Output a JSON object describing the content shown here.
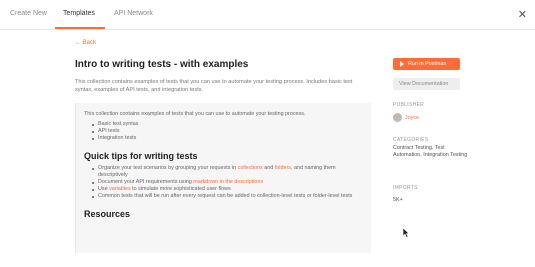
{
  "tabs": [
    {
      "label": "Create New"
    },
    {
      "label": "Templates"
    },
    {
      "label": "API Network"
    }
  ],
  "back_label": "Back",
  "title": "Intro to writing tests - with examples",
  "description": "This collection contains examples of tests that you can use to automate your testing process. Includes basic test syntax, examples of API tests, and integration tests.",
  "content": {
    "intro": "This collection contains examples of tests that you can use to automate your testing process.",
    "intro_list": [
      "Basic test syntax",
      "API tests",
      "Integration tests"
    ],
    "quick_tips_heading": "Quick tips for writing tests",
    "tips": [
      {
        "pre": "Organize your test scenarios by grouping your requests in ",
        "link1": "collections",
        "mid": " and ",
        "link2": "folders",
        "post": ", and naming them descriptively"
      },
      {
        "pre": "Document your API requirements using ",
        "link1": "markdown in the descriptions",
        "mid": "",
        "link2": "",
        "post": ""
      },
      {
        "pre": "Use ",
        "link1": "variables",
        "mid": "",
        "link2": "",
        "post": " to simulate more sophisticated user flows"
      },
      {
        "pre": "Common tests that will be run after every request can be added to collection-level tests or folder-level tests",
        "link1": "",
        "mid": "",
        "link2": "",
        "post": ""
      }
    ],
    "resources_heading": "Resources"
  },
  "sidebar": {
    "run_label": "Run in Postman",
    "docs_label": "View Documentation",
    "publisher_heading": "PUBLISHER",
    "publisher_name": "Joyce",
    "categories_heading": "CATEGORIES",
    "categories": "Contract Testing, Test Automation, Integration Testing",
    "imports_heading": "IMPORTS",
    "imports_value": "5K+"
  },
  "colors": {
    "accent": "#ff6c37"
  },
  "icons": {
    "close": "close-icon",
    "play": "play-icon",
    "cursor": "mouse-cursor"
  }
}
